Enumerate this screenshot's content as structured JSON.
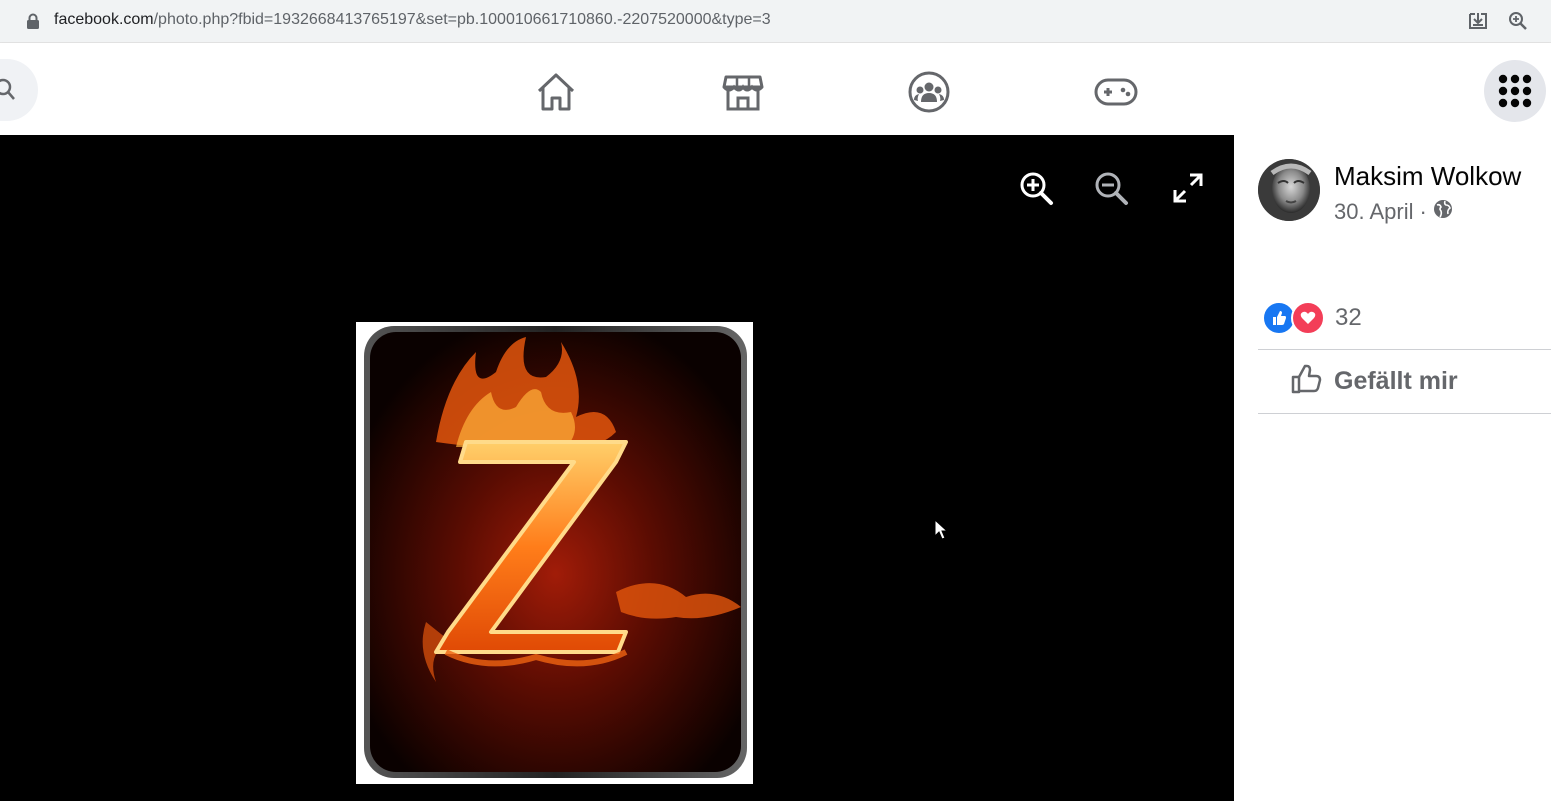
{
  "browser": {
    "url_host": "facebook.com",
    "url_path": "/photo.php?fbid=1932668413765197&set=pb.100010661710860.-2207520000&type=3"
  },
  "icons": {
    "lock": "lock-icon",
    "install": "install-app-icon",
    "zoom": "zoom-icon",
    "search": "search-icon",
    "home": "home-icon",
    "marketplace": "marketplace-icon",
    "groups": "groups-icon",
    "gaming": "gaming-icon",
    "menu": "menu-grid-icon"
  },
  "viewer": {
    "photo_letter": "Z"
  },
  "post": {
    "author": "Maksim Wolkow",
    "date": "30. April",
    "separator": "·",
    "reaction_count": "32",
    "like_label": "Gefällt mir"
  },
  "colors": {
    "like": "#1877f2",
    "love": "#f33e58",
    "viewer_bg": "#000000"
  }
}
